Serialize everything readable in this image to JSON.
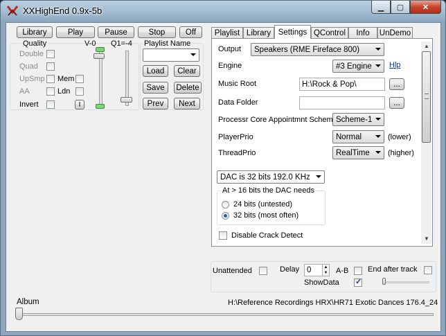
{
  "window": {
    "title": "XXHighEnd 0.9x-5b"
  },
  "transport": {
    "library": "Library",
    "play": "Play",
    "pause": "Pause",
    "stop": "Stop",
    "off": "Off"
  },
  "quality": {
    "title": "Quality",
    "double": "Double",
    "quad": "Quad",
    "upsmp": "UpSmp",
    "mem": "Mem",
    "aa": "AA",
    "ldn": "Ldn",
    "invert": "Invert",
    "i_button": "I",
    "v_label": "V-0",
    "q_label": "Q1=-4"
  },
  "playlist": {
    "name_label": "Playlist Name",
    "load": "Load",
    "clear": "Clear",
    "save": "Save",
    "delete": "Delete",
    "prev": "Prev",
    "next": "Next"
  },
  "tabs": [
    "Playlist",
    "Library",
    "Settings",
    "QControl",
    "Info",
    "UnDemo"
  ],
  "settings": {
    "output_label": "Output",
    "output_value": "Speakers (RME Fireface 800)",
    "engine_label": "Engine",
    "engine_value": "#3 Engine",
    "help_link": "Hlp",
    "music_root_label": "Music Root",
    "music_root_value": "H:\\Rock & Pop\\",
    "browse": "...",
    "data_folder_label": "Data Folder",
    "data_folder_value": "",
    "core_label": "Processr Core Appointmnt Scheme",
    "core_value": "Scheme-1",
    "player_prio_label": "PlayerPrio",
    "player_prio_value": "Normal",
    "player_prio_note": "(lower)",
    "thread_prio_label": "ThreadPrio",
    "thread_prio_value": "RealTime",
    "thread_prio_note": "(higher)",
    "dac_value": "DAC is 32 bits 192.0 KHz",
    "dac_group_title": "At > 16 bits the DAC needs",
    "radio_24": "24 bits (untested)",
    "radio_32": "32 bits (most often)",
    "radio_selected": "32",
    "crack_detect": "Disable Crack Detect"
  },
  "bottom": {
    "unattended": "Unattended",
    "delay_label": "Delay",
    "delay_value": "0",
    "ab": "A-B",
    "end_after_track": "End after track",
    "showdata": "ShowData",
    "showdata_checked": true
  },
  "album": {
    "label": "Album",
    "path": "H:\\Reference Recordings HRX\\HR71 Exotic Dances 176.4_24"
  }
}
